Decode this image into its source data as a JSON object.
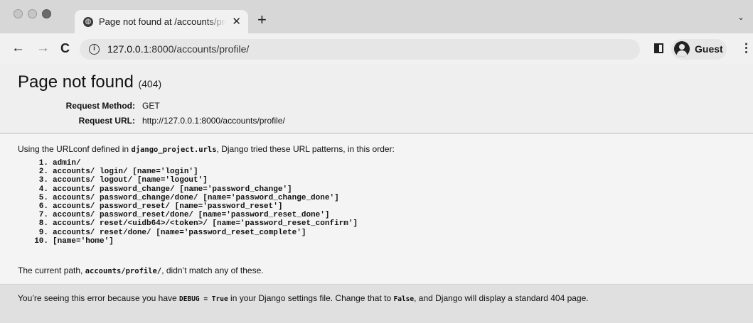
{
  "tab": {
    "title": "Page not found at /accounts/profile/",
    "close_glyph": "✕",
    "new_tab_glyph": "+",
    "tab_search_glyph": "⌄"
  },
  "toolbar": {
    "url_host": "127.0.0.1",
    "url_port_path": ":8000/accounts/profile/",
    "profile_name": "Guest",
    "menu_glyph": "⋮"
  },
  "page": {
    "title": "Page not found",
    "status_code": "(404)",
    "request_method_label": "Request Method:",
    "request_method": "GET",
    "request_url_label": "Request URL:",
    "request_url": "http://127.0.0.1:8000/accounts/profile/",
    "intro_prefix": "Using the URLconf defined in ",
    "urlconf": "django_project.urls",
    "intro_suffix": ", Django tried these URL patterns, in this order:",
    "patterns": [
      "admin/",
      "accounts/ login/ [name='login']",
      "accounts/ logout/ [name='logout']",
      "accounts/ password_change/ [name='password_change']",
      "accounts/ password_change/done/ [name='password_change_done']",
      "accounts/ password_reset/ [name='password_reset']",
      "accounts/ password_reset/done/ [name='password_reset_done']",
      "accounts/ reset/<uidb64>/<token>/ [name='password_reset_confirm']",
      "accounts/ reset/done/ [name='password_reset_complete']",
      "[name='home']"
    ],
    "outro_prefix": "The current path, ",
    "current_path": "accounts/profile/",
    "outro_suffix": ", didn’t match any of these.",
    "explain_1": "You’re seeing this error because you have ",
    "debug_setting": "DEBUG = True",
    "explain_2": " in your Django settings file. Change that to ",
    "false_value": "False",
    "explain_3": ", and Django will display a standard 404 page."
  }
}
